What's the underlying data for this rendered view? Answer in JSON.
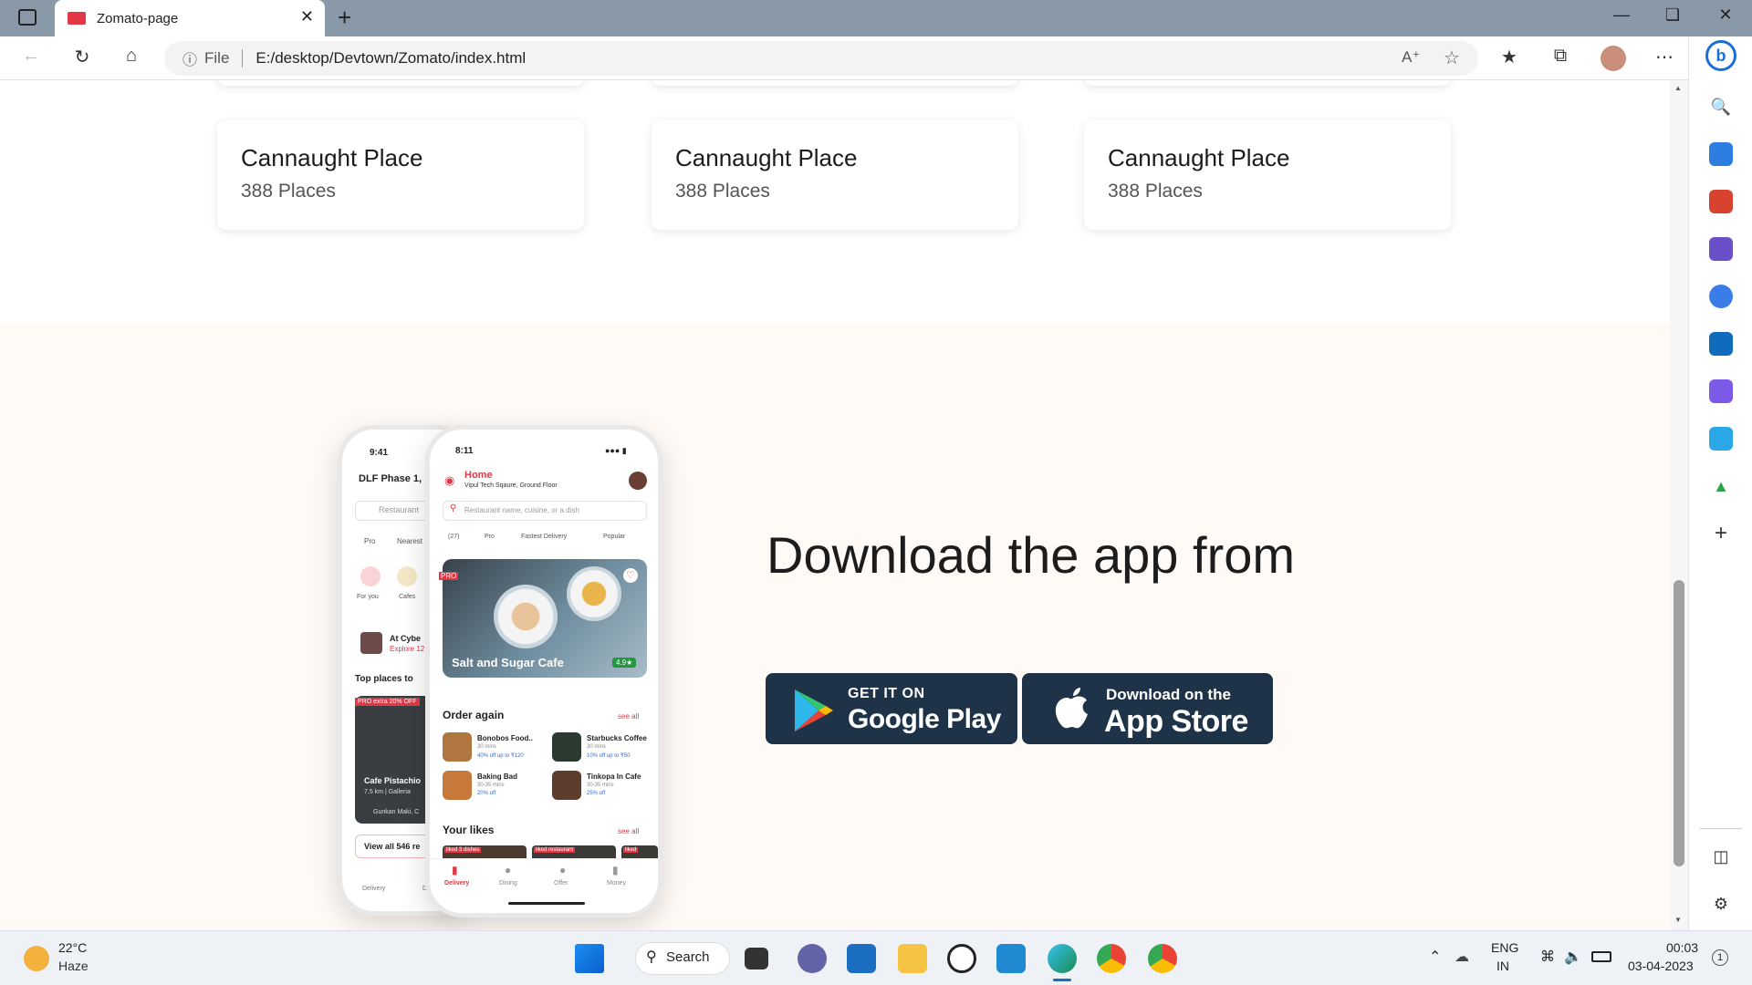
{
  "browser": {
    "tab_title": "Zomato-page",
    "tab_close": "✕",
    "new_tab": "+",
    "address_scheme": "File",
    "address_url": "E:/desktop/Devtown/Zomato/index.html"
  },
  "locations": [
    {
      "name": "Cannaught Place",
      "count": "388 Places"
    },
    {
      "name": "Cannaught Place",
      "count": "388 Places"
    },
    {
      "name": "Cannaught Place",
      "count": "388 Places"
    }
  ],
  "download": {
    "title": "Download the app from",
    "google_small": "GET IT ON",
    "google_big": "Google Play",
    "apple_small": "Download on the",
    "apple_big": "App Store"
  },
  "phone_back": {
    "time": "9:41",
    "location": "DLF Phase 1,",
    "search": "Restaurant",
    "chip1": "Pro",
    "chip2": "Nearest",
    "cat1": "For you",
    "cat2": "Cafes",
    "item_title": "At Cybe",
    "item_sub": "Explore 12",
    "section": "Top places to",
    "pro_tag": "PRO extra 20% OFF",
    "place_name": "Cafe Pistachio",
    "place_meta": "7.5 km | Galleria",
    "place_owner": "Gunkan Maki, C",
    "view_all": "View all 546 re",
    "nav1": "Delivery",
    "nav2": "Di"
  },
  "phone_front": {
    "time": "8:11",
    "home": "Home",
    "address": "Vipul Tech Sqaure, Ground Floor",
    "search_placeholder": "Restaurant name, cuisine, or a dish",
    "chips": [
      "(27)",
      "Pro",
      "Fastest Delivery",
      "Popular"
    ],
    "pro_badge": "PRO",
    "hero_name": "Salt and Sugar Cafe",
    "hero_rating": "4.9★",
    "order_again": "Order again",
    "see_all": "see all",
    "orders": [
      {
        "name": "Bonobos Food..",
        "time": "30 mins",
        "offer": "40% off up to ₹120"
      },
      {
        "name": "Starbucks Coffee",
        "time": "30 mins",
        "offer": "10% off up to ₹50"
      },
      {
        "name": "Baking Bad",
        "time": "30-35 mins",
        "offer": "20% off"
      },
      {
        "name": "Tinkopa In Cafe",
        "time": "30-35 mins",
        "offer": "25% off"
      }
    ],
    "your_likes": "Your likes",
    "likes_see_all": "see all",
    "like_tags": [
      "liked 3 dishes",
      "liked restaurant",
      "liked"
    ],
    "nav": [
      "Delivery",
      "Dining",
      "Offer",
      "Money"
    ]
  },
  "taskbar": {
    "weather_temp": "22°C",
    "weather_desc": "Haze",
    "search_label": "Search",
    "lang1": "ENG",
    "lang2": "IN",
    "time": "00:03",
    "date": "03-04-2023",
    "notif_count": "1"
  },
  "colors": {
    "brand": "#e23744",
    "store_button": "#1e3348",
    "section_bg": "#fffaf6"
  }
}
